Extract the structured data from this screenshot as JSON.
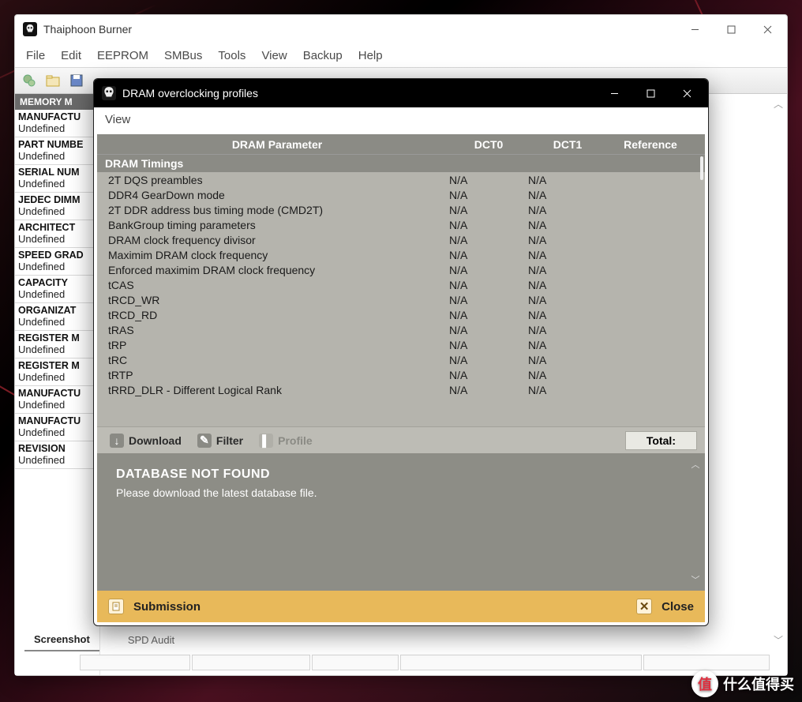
{
  "main_window": {
    "title": "Thaiphoon Burner",
    "menus": [
      "File",
      "Edit",
      "EEPROM",
      "SMBus",
      "Tools",
      "View",
      "Backup",
      "Help"
    ],
    "section_header": "MEMORY M",
    "fields": [
      {
        "label": "MANUFACTU",
        "value": "Undefined"
      },
      {
        "label": "PART NUMBE",
        "value": "Undefined"
      },
      {
        "label": "SERIAL NUM",
        "value": "Undefined"
      },
      {
        "label": "JEDEC DIMM",
        "value": "Undefined"
      },
      {
        "label": "ARCHITECT",
        "value": "Undefined"
      },
      {
        "label": "SPEED GRAD",
        "value": "Undefined"
      },
      {
        "label": "CAPACITY",
        "value": "Undefined"
      },
      {
        "label": "ORGANIZAT",
        "value": "Undefined"
      },
      {
        "label": "REGISTER M",
        "value": "Undefined"
      },
      {
        "label": "REGISTER M",
        "value": "Undefined"
      },
      {
        "label": "MANUFACTU",
        "value": "Undefined"
      },
      {
        "label": "MANUFACTU",
        "value": "Undefined"
      },
      {
        "label": "REVISION",
        "value": "Undefined"
      }
    ],
    "tabs": [
      "Screenshot",
      "SPD Audit"
    ],
    "active_tab": 0
  },
  "dialog": {
    "title": "DRAM overclocking profiles",
    "menus": [
      "View"
    ],
    "columns": [
      "DRAM Parameter",
      "DCT0",
      "DCT1",
      "Reference"
    ],
    "group": "DRAM Timings",
    "rows": [
      {
        "param": "2T DQS preambles",
        "dct0": "N/A",
        "dct1": "N/A",
        "ref": ""
      },
      {
        "param": "DDR4 GearDown mode",
        "dct0": "N/A",
        "dct1": "N/A",
        "ref": ""
      },
      {
        "param": "2T DDR address bus timing mode (CMD2T)",
        "dct0": "N/A",
        "dct1": "N/A",
        "ref": ""
      },
      {
        "param": "BankGroup timing parameters",
        "dct0": "N/A",
        "dct1": "N/A",
        "ref": ""
      },
      {
        "param": "DRAM clock frequency divisor",
        "dct0": "N/A",
        "dct1": "N/A",
        "ref": ""
      },
      {
        "param": "Maximim DRAM clock frequency",
        "dct0": "N/A",
        "dct1": "N/A",
        "ref": ""
      },
      {
        "param": "Enforced maximim DRAM clock frequency",
        "dct0": "N/A",
        "dct1": "N/A",
        "ref": ""
      },
      {
        "param": "tCAS",
        "dct0": "N/A",
        "dct1": "N/A",
        "ref": ""
      },
      {
        "param": "tRCD_WR",
        "dct0": "N/A",
        "dct1": "N/A",
        "ref": ""
      },
      {
        "param": "tRCD_RD",
        "dct0": "N/A",
        "dct1": "N/A",
        "ref": ""
      },
      {
        "param": "tRAS",
        "dct0": "N/A",
        "dct1": "N/A",
        "ref": ""
      },
      {
        "param": "tRP",
        "dct0": "N/A",
        "dct1": "N/A",
        "ref": ""
      },
      {
        "param": "tRC",
        "dct0": "N/A",
        "dct1": "N/A",
        "ref": ""
      },
      {
        "param": "tRTP",
        "dct0": "N/A",
        "dct1": "N/A",
        "ref": ""
      },
      {
        "param": "tRRD_DLR - Different Logical Rank",
        "dct0": "N/A",
        "dct1": "N/A",
        "ref": ""
      }
    ],
    "filterbar": {
      "download": "Download",
      "filter": "Filter",
      "profile": "Profile",
      "total_label": "Total:"
    },
    "message": {
      "title": "DATABASE NOT FOUND",
      "body": "Please download the latest database file."
    },
    "footer": {
      "submission": "Submission",
      "close": "Close"
    }
  },
  "watermark": "什么值得买"
}
